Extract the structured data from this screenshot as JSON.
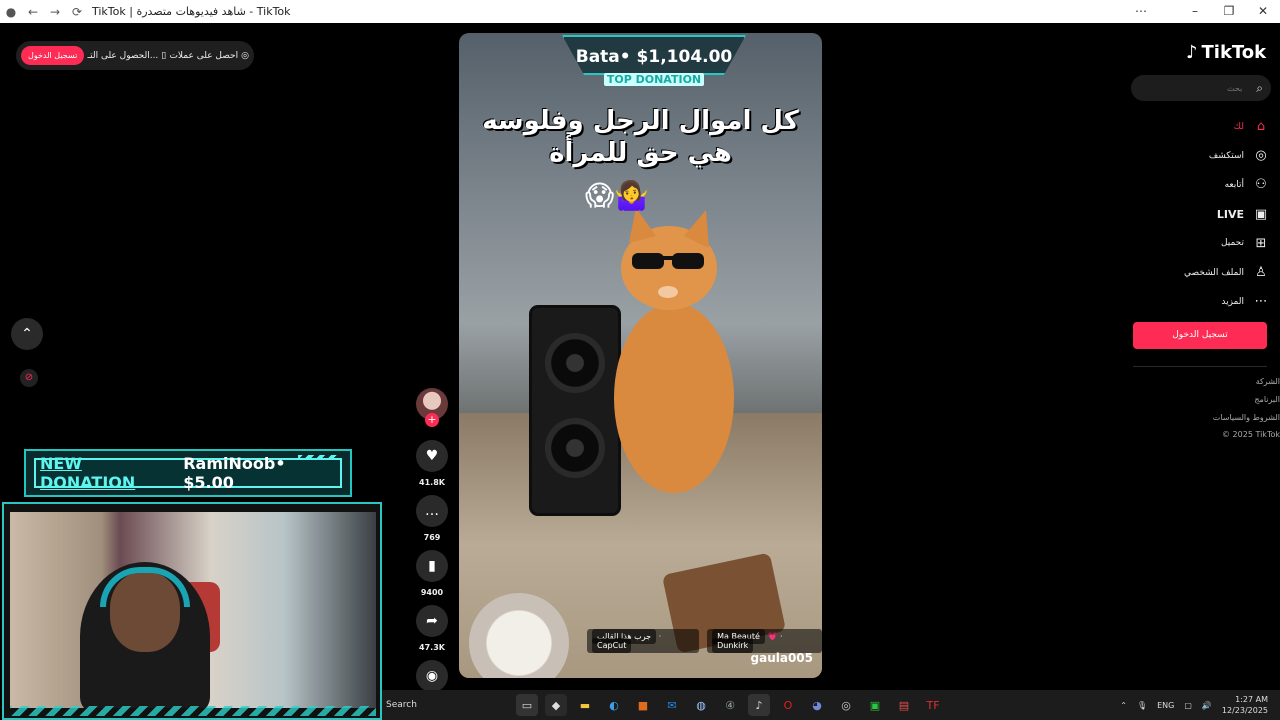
{
  "window": {
    "title": "TikTok | شاهد فيديوهات متصدرة - TikTok"
  },
  "topbar": {
    "coins_label": "احصل على عملات",
    "app_label": "الحصول على التـ...",
    "signup_label": "تسجيل الدخول"
  },
  "video": {
    "caption_line1": "كل اموال الرجل وفلوسه",
    "caption_line2": "هي حق للمرأة",
    "username": "gaula005",
    "music_dunkirk": "Dunkirk",
    "music_ma_beaute": "Ma Beauté",
    "capcut": "CapCut",
    "capcut_try": "جرب هذا القالب"
  },
  "overlay": {
    "top_donation_amount": "Bata• $1,104.00",
    "top_donation_label": "TOP DONATION",
    "new_donation_label": "NEW DONATION",
    "new_donation_text": "RamiNoob• $5.00"
  },
  "actions": {
    "likes": "41.8K",
    "comments": "769",
    "saves": "9400",
    "shares": "47.3K"
  },
  "sidebar": {
    "logo": "TikTok",
    "search_placeholder": "بحث",
    "items": [
      {
        "label": "لك",
        "icon": "home-icon"
      },
      {
        "label": "استكشف",
        "icon": "compass-icon"
      },
      {
        "label": "أتابعه",
        "icon": "user-plus-icon"
      },
      {
        "label": "LIVE",
        "icon": "live-icon"
      },
      {
        "label": "تحميل",
        "icon": "upload-icon"
      },
      {
        "label": "الملف الشخصي",
        "icon": "profile-icon"
      },
      {
        "label": "المزيد",
        "icon": "more-icon"
      }
    ],
    "signup_button": "تسجيل الدخول",
    "footer": {
      "company": "الشركة",
      "program": "البرنامج",
      "terms": "الشروط والسياسات",
      "copyright": "© 2025 TikTok"
    }
  },
  "taskbar": {
    "search": "Search",
    "lang": "ENG",
    "time": "1:27 AM",
    "date": "12/23/2025"
  },
  "colors": {
    "accent": "#fe2c55",
    "overlay_teal": "#27c7c2"
  }
}
